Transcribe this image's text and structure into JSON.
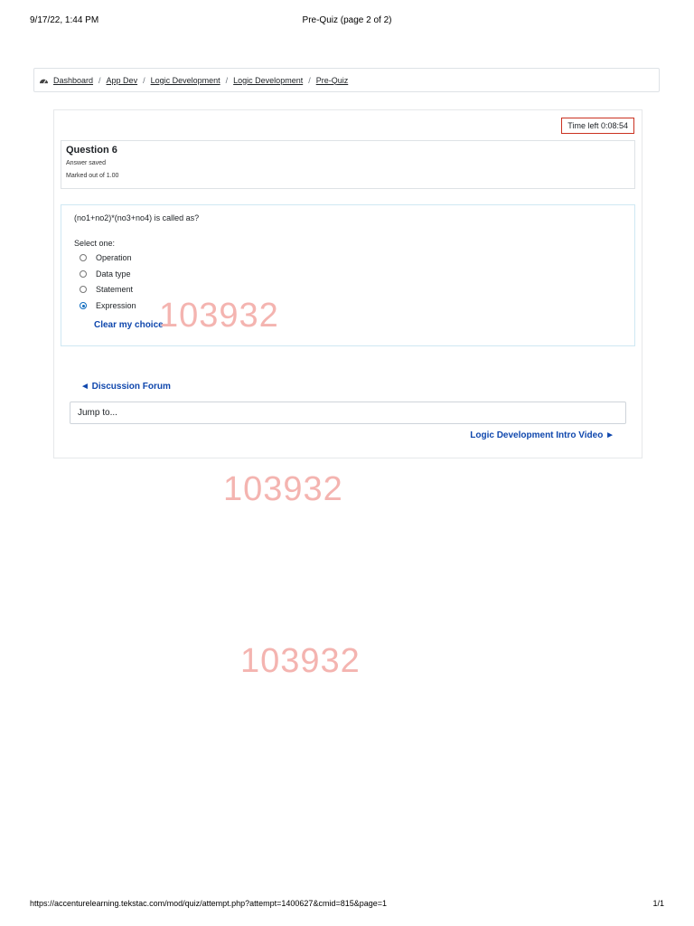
{
  "print_header": {
    "datetime": "9/17/22, 1:44 PM",
    "doc_title": "Pre-Quiz (page 2 of 2)"
  },
  "breadcrumb": {
    "icon": "dashboard-gauge-icon",
    "items": [
      "Dashboard",
      "App Dev",
      "Logic Development",
      "Logic Development",
      "Pre-Quiz"
    ],
    "separator": "/"
  },
  "timer": {
    "label": "Time left 0:08:54"
  },
  "question": {
    "number_label": "Question 6",
    "state": "Answer saved",
    "grade": "Marked out of 1.00",
    "text": "(no1+no2)*(no3+no4) is called as?",
    "prompt": "Select one:",
    "options": [
      "Operation",
      "Data type",
      "Statement",
      "Expression"
    ],
    "selected": "Expression",
    "clear_label": "Clear my choice"
  },
  "watermark": "103932",
  "navigation": {
    "prev_label": "◄ Discussion Forum",
    "jump_placeholder": "Jump to...",
    "next_label": "Logic Development Intro Video ►"
  },
  "print_footer": {
    "url": "https://accenturelearning.tekstac.com/mod/quiz/attempt.php?attempt=1400627&cmid=815&page=1",
    "page": "1/1"
  },
  "colors": {
    "link": "#0f47ad",
    "timer_border": "#ca3120",
    "watermark": "#f4b4b0",
    "radio_checked": "#0f6cbf"
  }
}
